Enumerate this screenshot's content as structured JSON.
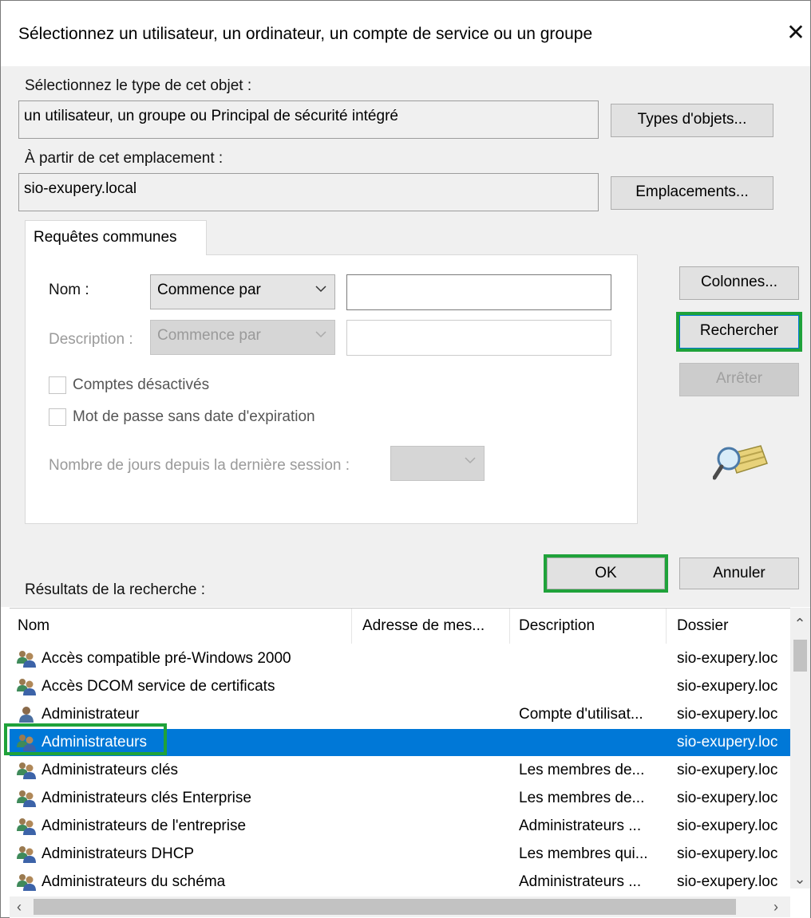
{
  "dialog": {
    "title": "Sélectionnez un utilisateur, un ordinateur, un compte de service ou un groupe",
    "close_glyph": "✕"
  },
  "object_type": {
    "label": "Sélectionnez le type de cet objet :",
    "value": "un utilisateur, un groupe ou Principal de sécurité intégré",
    "button": "Types d'objets..."
  },
  "location": {
    "label": "À partir de cet emplacement :",
    "value": "sio-exupery.local",
    "button": "Emplacements..."
  },
  "tab": {
    "label": "Requêtes communes"
  },
  "query": {
    "name_label": "Nom :",
    "name_mode": "Commence par",
    "name_value": "",
    "desc_label": "Description :",
    "desc_mode": "Commence par",
    "desc_value": "",
    "disabled_accounts_label": "Comptes désactivés",
    "no_expiry_label": "Mot de passe sans date d'expiration",
    "days_label": "Nombre de jours depuis la dernière session :",
    "days_value": ""
  },
  "side_buttons": {
    "columns": "Colonnes...",
    "search": "Rechercher",
    "stop": "Arrêter"
  },
  "footer_buttons": {
    "ok": "OK",
    "cancel": "Annuler"
  },
  "results": {
    "label": "Résultats de la recherche :",
    "columns": [
      "Nom",
      "Adresse de mes...",
      "Description",
      "Dossier"
    ],
    "rows": [
      {
        "icon": "group-icon",
        "name": "Accès compatible pré-Windows 2000",
        "email": "",
        "description": "",
        "folder": "sio-exupery.loc",
        "selected": false
      },
      {
        "icon": "group-icon",
        "name": "Accès DCOM service de certificats",
        "email": "",
        "description": "",
        "folder": "sio-exupery.loc",
        "selected": false
      },
      {
        "icon": "user-icon",
        "name": "Administrateur",
        "email": "",
        "description": "Compte d'utilisat...",
        "folder": "sio-exupery.loc",
        "selected": false
      },
      {
        "icon": "group-icon",
        "name": "Administrateurs",
        "email": "",
        "description": "",
        "folder": "sio-exupery.loc",
        "selected": true
      },
      {
        "icon": "group-icon",
        "name": "Administrateurs clés",
        "email": "",
        "description": "Les membres de...",
        "folder": "sio-exupery.loc",
        "selected": false
      },
      {
        "icon": "group-icon",
        "name": "Administrateurs clés Enterprise",
        "email": "",
        "description": "Les membres de...",
        "folder": "sio-exupery.loc",
        "selected": false
      },
      {
        "icon": "group-icon",
        "name": "Administrateurs de l'entreprise",
        "email": "",
        "description": "Administrateurs ...",
        "folder": "sio-exupery.loc",
        "selected": false
      },
      {
        "icon": "group-icon",
        "name": "Administrateurs DHCP",
        "email": "",
        "description": "Les membres qui...",
        "folder": "sio-exupery.loc",
        "selected": false
      },
      {
        "icon": "group-icon",
        "name": "Administrateurs du schéma",
        "email": "",
        "description": "Administrateurs ...",
        "folder": "sio-exupery.loc",
        "selected": false
      }
    ]
  },
  "colors": {
    "selection": "#0078d7",
    "highlight_box": "#1fa23a",
    "dialog_bg": "#f0f0f0"
  }
}
